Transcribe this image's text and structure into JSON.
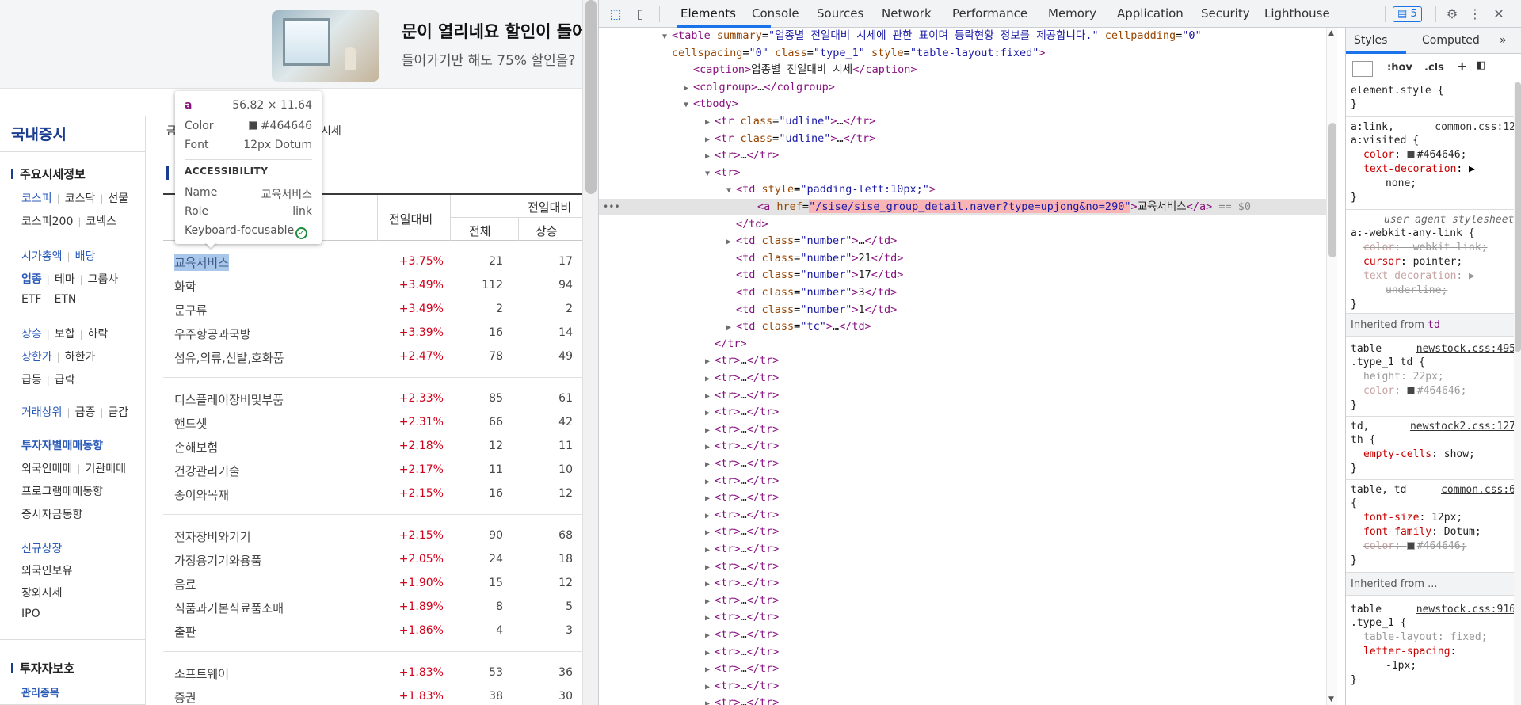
{
  "ad": {
    "title": "문이 열리네요 할인이 들어",
    "subtitle": "들어가기만 해도 75% 할인을?"
  },
  "lnb": {
    "title": "국내증시",
    "section1": "주요시세정보",
    "items": {
      "kospi": "코스피",
      "kosdaq": "코스닥",
      "futures": "선물",
      "kospi200": "코스피200",
      "konex": "코넥스",
      "market_cap": "시가총액",
      "dividend": "배당",
      "industry": "업종",
      "theme": "테마",
      "group": "그룹사",
      "etf": "ETF",
      "etn": "ETN",
      "rise": "상승",
      "flat": "보합",
      "fall": "하락",
      "upper_limit": "상한가",
      "lower_limit": "하한가",
      "surge": "급등",
      "plunge": "급락",
      "volume_top": "거래상위",
      "volume_surge": "급증",
      "volume_drop": "급감",
      "investor_trend": "투자자별매매동향",
      "foreign_trade": "외국인매매",
      "institution_trade": "기관매매",
      "program_trade": "프로그램매매동향",
      "deposit": "증시자금동향",
      "new_listing": "신규상장",
      "foreign_holding": "외국인보유",
      "otc": "장외시세",
      "ipo": "IPO"
    },
    "section2": "투자자보호",
    "managed": "관리종목"
  },
  "content": {
    "crumb_left": "금",
    "crumb_right": "시세",
    "table": {
      "col_change": "전일대비",
      "col_group": "전일대비",
      "col_total": "전체",
      "col_up": "상승",
      "rows": [
        {
          "name": "교육서비스",
          "pct": "+3.75%",
          "total": "21",
          "up": "17"
        },
        {
          "name": "화학",
          "pct": "+3.49%",
          "total": "112",
          "up": "94"
        },
        {
          "name": "문구류",
          "pct": "+3.49%",
          "total": "2",
          "up": "2"
        },
        {
          "name": "우주항공과국방",
          "pct": "+3.39%",
          "total": "16",
          "up": "14"
        },
        {
          "name": "섬유,의류,신발,호화품",
          "pct": "+2.47%",
          "total": "78",
          "up": "49"
        },
        {
          "name": "디스플레이장비및부품",
          "pct": "+2.33%",
          "total": "85",
          "up": "61"
        },
        {
          "name": "핸드셋",
          "pct": "+2.31%",
          "total": "66",
          "up": "42"
        },
        {
          "name": "손해보험",
          "pct": "+2.18%",
          "total": "12",
          "up": "11"
        },
        {
          "name": "건강관리기술",
          "pct": "+2.17%",
          "total": "11",
          "up": "10"
        },
        {
          "name": "종이와목재",
          "pct": "+2.15%",
          "total": "16",
          "up": "12"
        },
        {
          "name": "전자장비와기기",
          "pct": "+2.15%",
          "total": "90",
          "up": "68"
        },
        {
          "name": "가정용기기와용품",
          "pct": "+2.05%",
          "total": "24",
          "up": "18"
        },
        {
          "name": "음료",
          "pct": "+1.90%",
          "total": "15",
          "up": "12"
        },
        {
          "name": "식품과기본식료품소매",
          "pct": "+1.89%",
          "total": "8",
          "up": "5"
        },
        {
          "name": "출판",
          "pct": "+1.86%",
          "total": "4",
          "up": "3"
        },
        {
          "name": "소프트웨어",
          "pct": "+1.83%",
          "total": "53",
          "up": "36"
        },
        {
          "name": "증권",
          "pct": "+1.83%",
          "total": "38",
          "up": "30"
        }
      ]
    }
  },
  "tooltip": {
    "tag": "a",
    "size": "56.82 × 11.64",
    "color_label": "Color",
    "color_value": "#464646",
    "font_label": "Font",
    "font_value": "12px Dotum",
    "accessibility": "ACCESSIBILITY",
    "name_label": "Name",
    "name_value": "교육서비스",
    "role_label": "Role",
    "role_value": "link",
    "focus_label": "Keyboard-focusable"
  },
  "devtools": {
    "tabs": [
      "Elements",
      "Console",
      "Sources",
      "Network",
      "Performance",
      "Memory",
      "Application",
      "Security",
      "Lighthouse"
    ],
    "active_tab": "Elements",
    "issues_count": "5",
    "issues_icon": "message-icon",
    "elements_lines": [
      {
        "indent": 0,
        "tri": "▼",
        "html": "<span class='tg'>&lt;table</span> <span class='an'>summary</span>=<span class='av'>\"업종별 전일대비 시세에 관한 표이며 등락현황 정보를 제공합니다.\"</span> <span class='an'>cellpadding</span>=<span class='av'>\"0\"</span>"
      },
      {
        "indent": 0,
        "tri": "",
        "html": "<span class='an'>cellspacing</span>=<span class='av'>\"0\"</span> <span class='an'>class</span>=<span class='av'>\"type_1\"</span> <span class='an'>style</span>=<span class='av'>\"table-layout:fixed\"</span><span class='tg'>&gt;</span>"
      },
      {
        "indent": 1,
        "tri": "",
        "html": "<span class='tg'>&lt;caption&gt;</span><span class='tx'>업종별 전일대비 시세</span><span class='tg'>&lt;/caption&gt;</span>"
      },
      {
        "indent": 1,
        "tri": "▶",
        "html": "<span class='tg'>&lt;colgroup&gt;</span><span class='tx'>…</span><span class='tg'>&lt;/colgroup&gt;</span>"
      },
      {
        "indent": 1,
        "tri": "▼",
        "html": "<span class='tg'>&lt;tbody&gt;</span>"
      },
      {
        "indent": 2,
        "tri": "▶",
        "html": "<span class='tg'>&lt;tr</span> <span class='an'>class</span>=<span class='av'>\"udline\"</span><span class='tg'>&gt;</span><span class='tx'>…</span><span class='tg'>&lt;/tr&gt;</span>"
      },
      {
        "indent": 2,
        "tri": "▶",
        "html": "<span class='tg'>&lt;tr</span> <span class='an'>class</span>=<span class='av'>\"udline\"</span><span class='tg'>&gt;</span><span class='tx'>…</span><span class='tg'>&lt;/tr&gt;</span>"
      },
      {
        "indent": 2,
        "tri": "▶",
        "html": "<span class='tg'>&lt;tr&gt;</span><span class='tx'>…</span><span class='tg'>&lt;/tr&gt;</span>"
      },
      {
        "indent": 2,
        "tri": "▼",
        "html": "<span class='tg'>&lt;tr&gt;</span>"
      },
      {
        "indent": 3,
        "tri": "▼",
        "html": "<span class='tg'>&lt;td</span> <span class='an'>style</span>=<span class='av'>\"padding-left:10px;\"</span><span class='tg'>&gt;</span>"
      },
      {
        "indent": 4,
        "tri": "",
        "sel": true,
        "html": "<span class='tg'>&lt;a</span> <span class='an'>href</span>=<span class='link-hl'>\"/sise/sise_group_detail.naver?type=upjong&amp;no=290\"</span><span class='tg'>&gt;</span><span class='tx'>교육서비스</span><span class='tg'>&lt;/a&gt;</span> <span class='cm'>== $0</span>"
      },
      {
        "indent": 3,
        "tri": "",
        "html": "<span class='tg'>&lt;/td&gt;</span>"
      },
      {
        "indent": 3,
        "tri": "▶",
        "html": "<span class='tg'>&lt;td</span> <span class='an'>class</span>=<span class='av'>\"number\"</span><span class='tg'>&gt;</span><span class='tx'>…</span><span class='tg'>&lt;/td&gt;</span>"
      },
      {
        "indent": 3,
        "tri": "",
        "html": "<span class='tg'>&lt;td</span> <span class='an'>class</span>=<span class='av'>\"number\"</span><span class='tg'>&gt;</span><span class='tx'>21</span><span class='tg'>&lt;/td&gt;</span>"
      },
      {
        "indent": 3,
        "tri": "",
        "html": "<span class='tg'>&lt;td</span> <span class='an'>class</span>=<span class='av'>\"number\"</span><span class='tg'>&gt;</span><span class='tx'>17</span><span class='tg'>&lt;/td&gt;</span>"
      },
      {
        "indent": 3,
        "tri": "",
        "html": "<span class='tg'>&lt;td</span> <span class='an'>class</span>=<span class='av'>\"number\"</span><span class='tg'>&gt;</span><span class='tx'>3</span><span class='tg'>&lt;/td&gt;</span>"
      },
      {
        "indent": 3,
        "tri": "",
        "html": "<span class='tg'>&lt;td</span> <span class='an'>class</span>=<span class='av'>\"number\"</span><span class='tg'>&gt;</span><span class='tx'>1</span><span class='tg'>&lt;/td&gt;</span>"
      },
      {
        "indent": 3,
        "tri": "▶",
        "html": "<span class='tg'>&lt;td</span> <span class='an'>class</span>=<span class='av'>\"tc\"</span><span class='tg'>&gt;</span><span class='tx'>…</span><span class='tg'>&lt;/td&gt;</span>"
      },
      {
        "indent": 2,
        "tri": "",
        "html": "<span class='tg'>&lt;/tr&gt;</span>"
      }
    ],
    "collapsed_tr": "<span class='tg'>&lt;tr&gt;</span><span class='tx'>…</span><span class='tg'>&lt;/tr&gt;</span>",
    "collapsed_tr_count": 21,
    "styles": {
      "tabs": [
        "Styles",
        "Computed"
      ],
      "filter_hov": ":hov",
      "filter_cls": ".cls"
    }
  }
}
